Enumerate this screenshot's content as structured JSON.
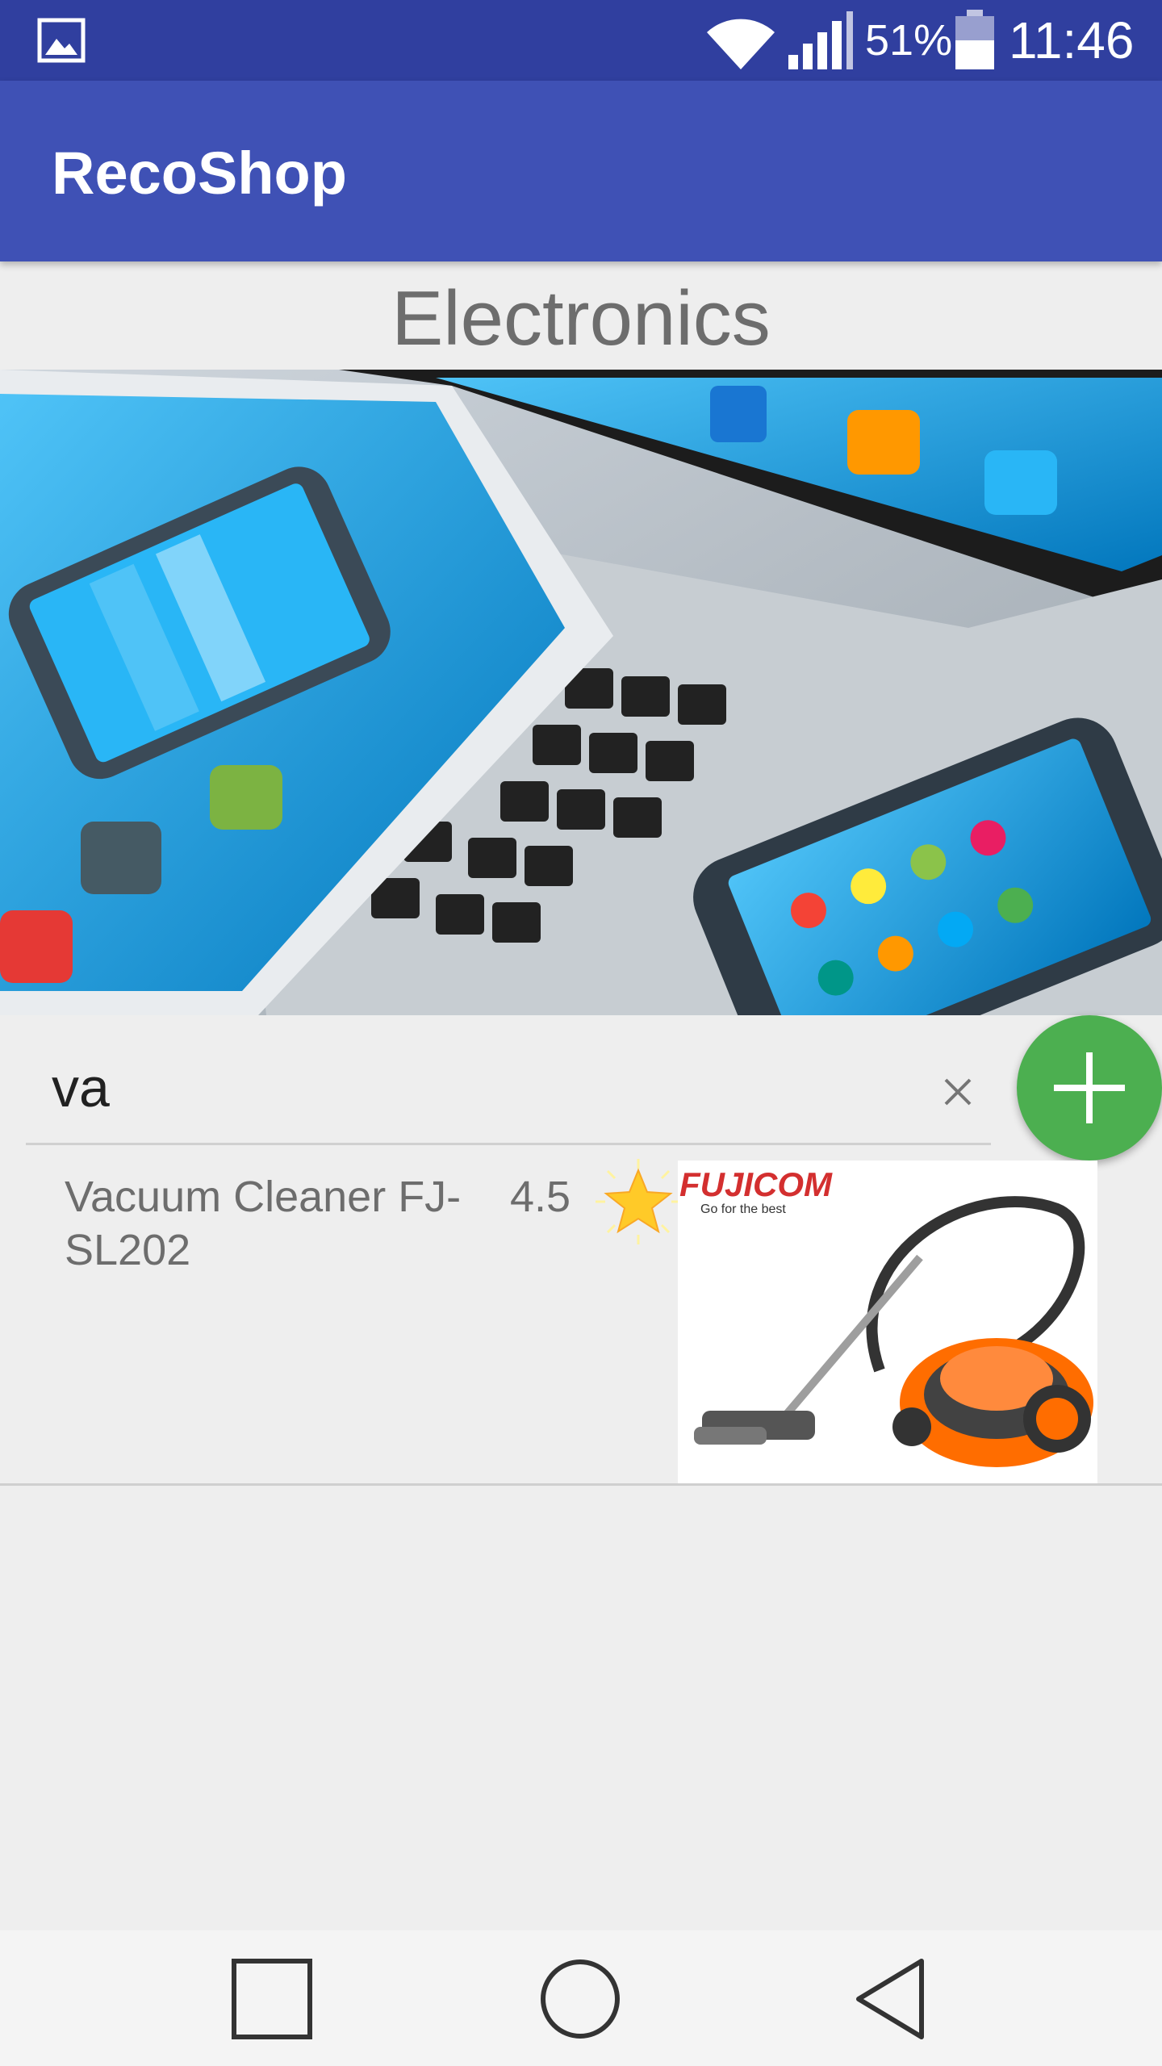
{
  "status_bar": {
    "battery_percent": "51%",
    "time": "11:46"
  },
  "app_bar": {
    "title": "RecoShop"
  },
  "category": {
    "title": "Electronics"
  },
  "search": {
    "value": "va"
  },
  "results": [
    {
      "name": "Vacuum Cleaner FJ-SL202",
      "rating": "4.5",
      "image_brand": "FUJICOM",
      "image_tagline": "Go for the best"
    }
  ],
  "icons": {
    "status": [
      "gallery-icon",
      "wifi-icon",
      "signal-icon",
      "battery-icon"
    ],
    "search_clear": "close-icon",
    "fab": "plus-icon",
    "rating": "star-icon",
    "nav": [
      "recents-icon",
      "home-icon",
      "back-icon"
    ]
  },
  "colors": {
    "status_bar": "#303f9f",
    "app_bar": "#3f51b5",
    "fab": "#4caf50",
    "background": "#eeeeee"
  }
}
